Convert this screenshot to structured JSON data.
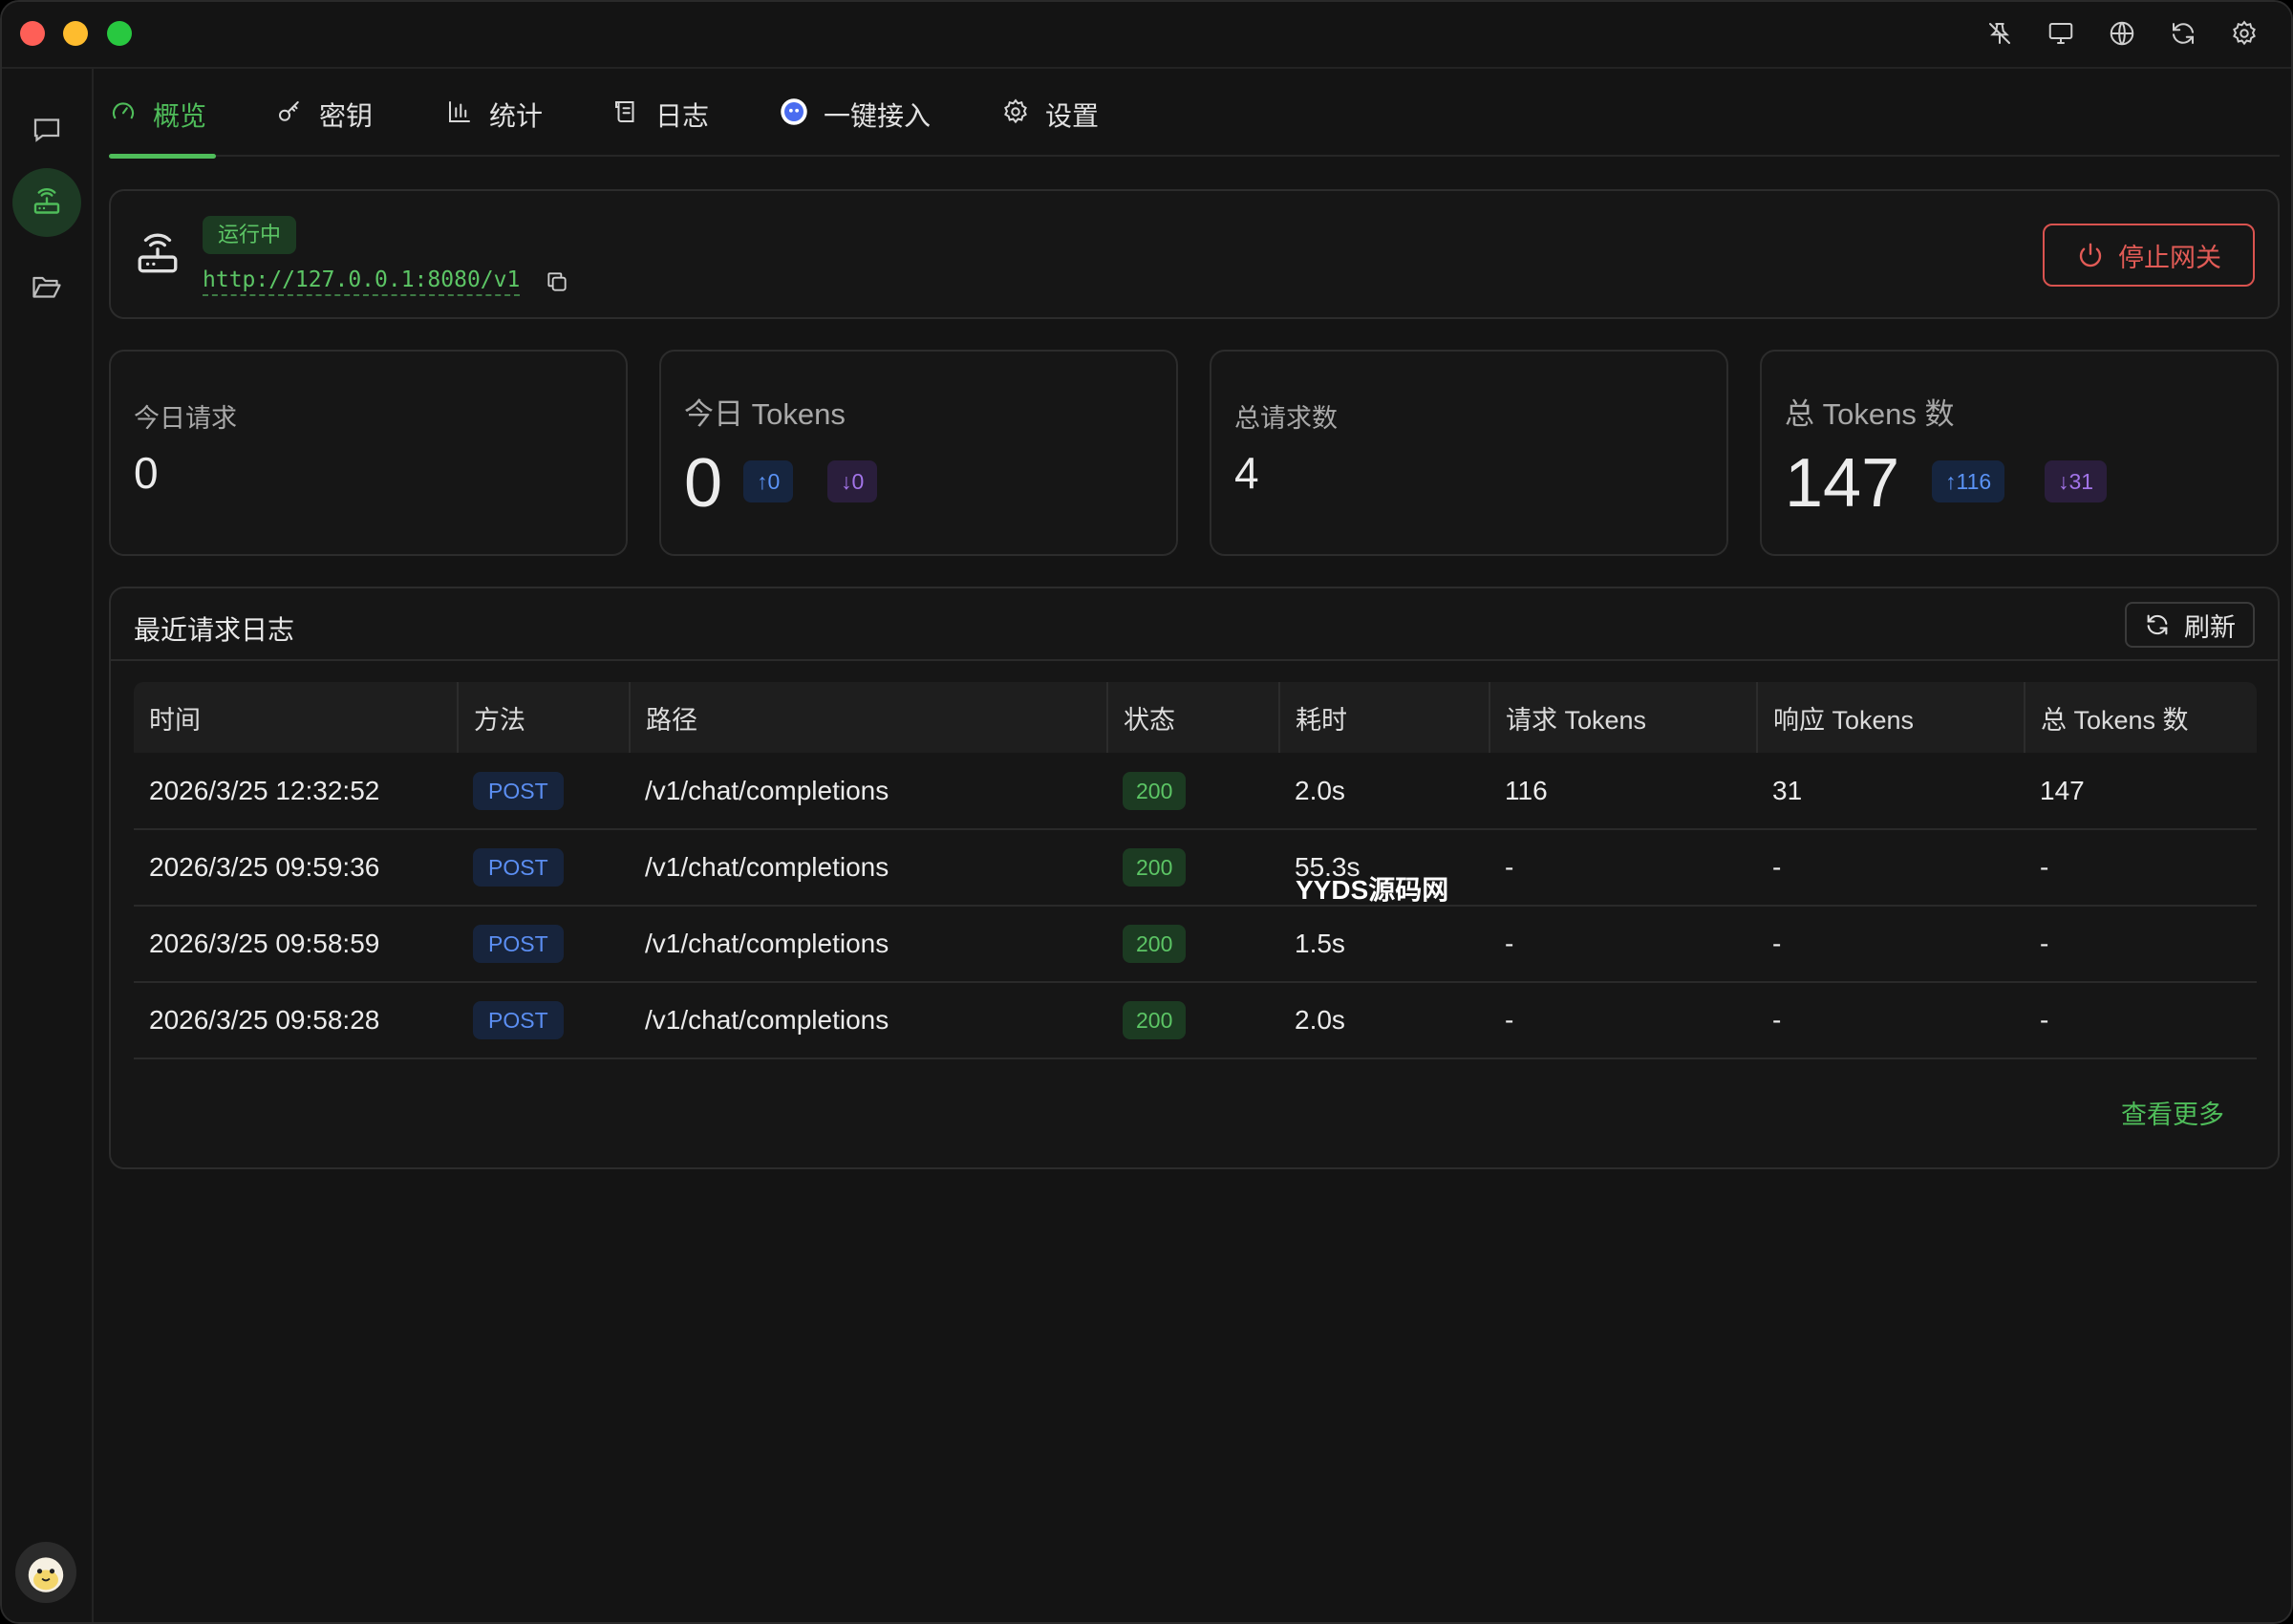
{
  "window": {
    "titlebar_icons": [
      "pin-off-icon",
      "monitor-icon",
      "globe-icon",
      "sync-icon",
      "gear-icon"
    ]
  },
  "sidebar": {
    "items": [
      {
        "name": "chat-icon",
        "active": false
      },
      {
        "name": "router-icon",
        "active": true
      },
      {
        "name": "folder-icon",
        "active": false
      }
    ]
  },
  "tabs": [
    {
      "label": "概览",
      "icon": "gauge-icon",
      "active": true
    },
    {
      "label": "密钥",
      "icon": "key-icon",
      "active": false
    },
    {
      "label": "统计",
      "icon": "bar-chart-icon",
      "active": false
    },
    {
      "label": "日志",
      "icon": "scroll-icon",
      "active": false
    },
    {
      "label": "一键接入",
      "icon": "app-logo-icon",
      "active": false
    },
    {
      "label": "设置",
      "icon": "gear-icon",
      "active": false
    }
  ],
  "gateway": {
    "status": "运行中",
    "url": "http://127.0.0.1:8080/v1",
    "stop_label": "停止网关"
  },
  "stats": {
    "today_requests": {
      "label": "今日请求",
      "value": "0"
    },
    "today_tokens": {
      "label": "今日 Tokens",
      "value": "0",
      "up": "↑0",
      "down": "↓0"
    },
    "total_requests": {
      "label": "总请求数",
      "value": "4"
    },
    "total_tokens": {
      "label": "总 Tokens 数",
      "value": "147",
      "up": "↑116",
      "down": "↓31"
    }
  },
  "logs": {
    "title": "最近请求日志",
    "refresh_label": "刷新",
    "more_label": "查看更多",
    "columns": [
      "时间",
      "方法",
      "路径",
      "状态",
      "耗时",
      "请求 Tokens",
      "响应 Tokens",
      "总 Tokens 数"
    ],
    "rows": [
      {
        "time": "2026/3/25 12:32:52",
        "method": "POST",
        "path": "/v1/chat/completions",
        "status": "200",
        "duration": "2.0s",
        "req": "116",
        "resp": "31",
        "total": "147"
      },
      {
        "time": "2026/3/25 09:59:36",
        "method": "POST",
        "path": "/v1/chat/completions",
        "status": "200",
        "duration": "55.3s",
        "req": "-",
        "resp": "-",
        "total": "-"
      },
      {
        "time": "2026/3/25 09:58:59",
        "method": "POST",
        "path": "/v1/chat/completions",
        "status": "200",
        "duration": "1.5s",
        "req": "-",
        "resp": "-",
        "total": "-"
      },
      {
        "time": "2026/3/25 09:58:28",
        "method": "POST",
        "path": "/v1/chat/completions",
        "status": "200",
        "duration": "2.0s",
        "req": "-",
        "resp": "-",
        "total": "-"
      }
    ]
  },
  "watermark": "YYDS源码网",
  "colors": {
    "accent": "#4fbd5a",
    "danger": "#e25b56",
    "up": "#5b93f5",
    "down": "#a274e8"
  }
}
